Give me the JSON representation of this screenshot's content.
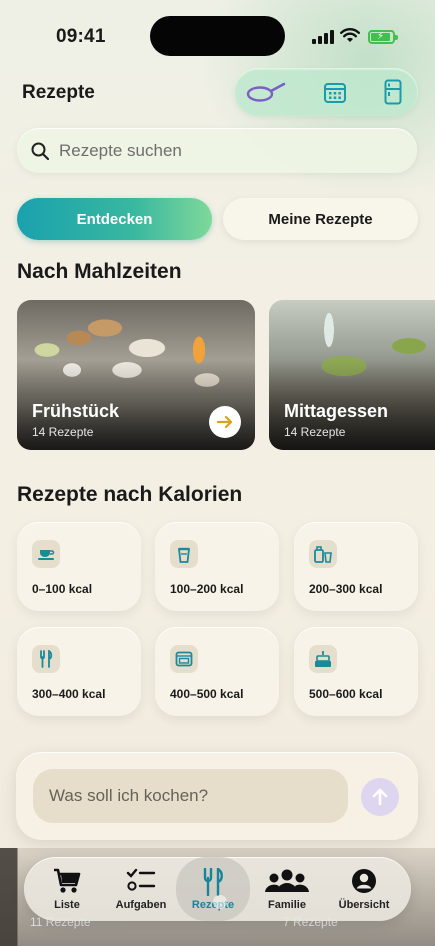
{
  "status_bar": {
    "time": "09:41"
  },
  "header": {
    "title": "Rezepte",
    "tools": [
      {
        "icon": "pan-icon"
      },
      {
        "icon": "calendar-icon"
      },
      {
        "icon": "fridge-icon"
      }
    ]
  },
  "search": {
    "placeholder": "Rezepte suchen",
    "value": ""
  },
  "segments": {
    "active": "Entdecken",
    "inactive": "Meine Rezepte"
  },
  "sections": {
    "meals_title": "Nach Mahlzeiten",
    "calories_title": "Rezepte nach Kalorien"
  },
  "meals": [
    {
      "name": "Frühstück",
      "count": "14 Rezepte"
    },
    {
      "name": "Mittagessen",
      "count": "14 Rezepte"
    }
  ],
  "calories": [
    {
      "label": "0–100 kcal",
      "icon": "teacup-icon"
    },
    {
      "label": "100–200 kcal",
      "icon": "drink-cup-icon"
    },
    {
      "label": "200–300 kcal",
      "icon": "shake-icon"
    },
    {
      "label": "300–400 kcal",
      "icon": "cutlery-icon"
    },
    {
      "label": "400–500 kcal",
      "icon": "oven-icon"
    },
    {
      "label": "500–600 kcal",
      "icon": "cake-icon"
    }
  ],
  "chat": {
    "placeholder": "Was soll ich kochen?"
  },
  "behind": {
    "count_1": "11 Rezepte",
    "count_2": "7 Rezepte"
  },
  "tabbar": {
    "items": [
      {
        "label": "Liste",
        "icon": "cart-icon"
      },
      {
        "label": "Aufgaben",
        "icon": "checklist-icon"
      },
      {
        "label": "Rezepte",
        "icon": "fork-knife-icon",
        "active": true
      },
      {
        "label": "Familie",
        "icon": "people-icon"
      },
      {
        "label": "Übersicht",
        "icon": "person-circle-icon"
      }
    ]
  },
  "colors": {
    "accent": "#16859a",
    "battery": "#41c04d",
    "tool_icon": "#1a9bab",
    "pan_icon": "#7a5fc8"
  }
}
